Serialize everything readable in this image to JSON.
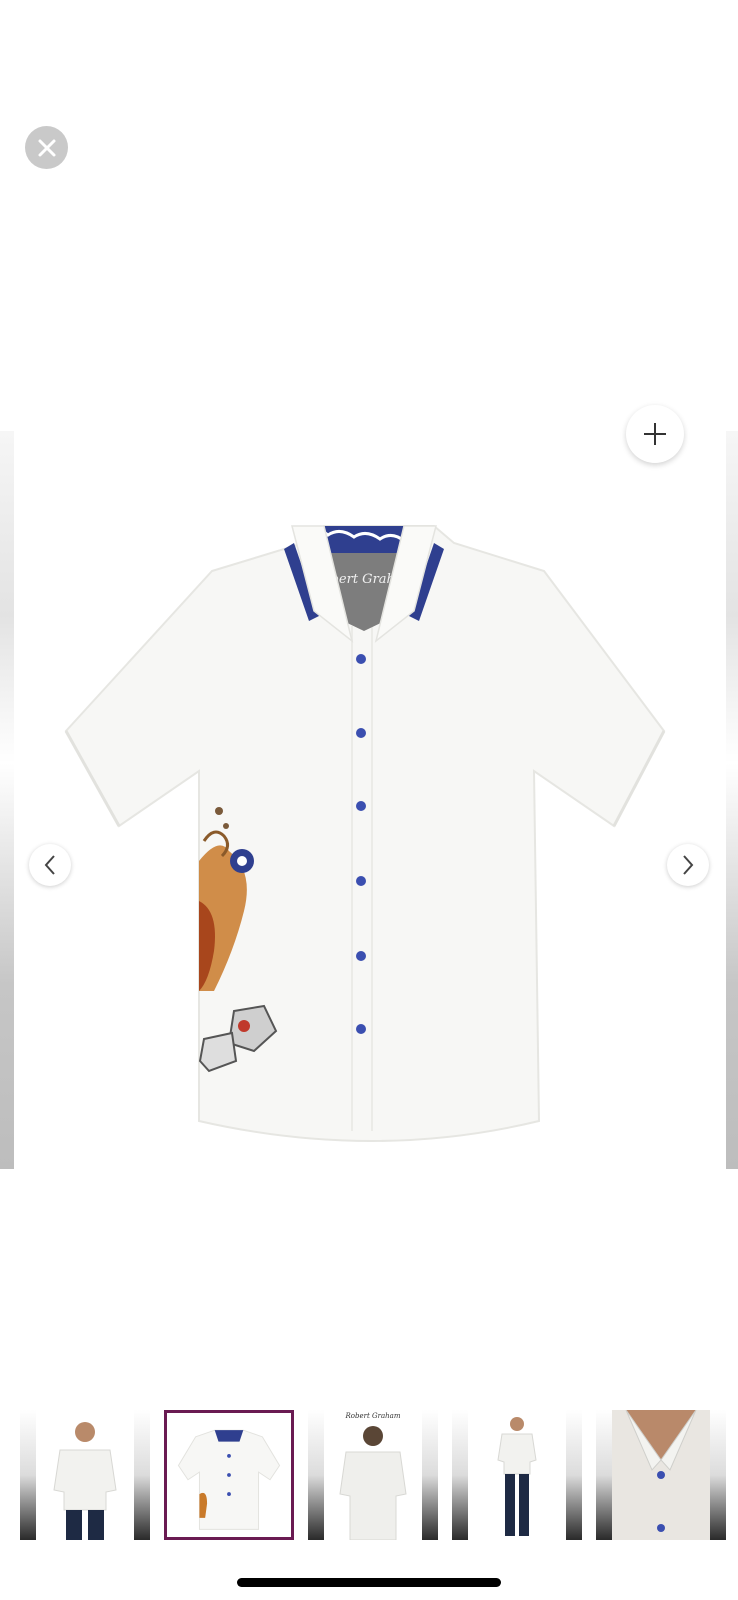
{
  "viewer": {
    "close_icon": "close-icon",
    "zoom_icon": "plus-icon",
    "prev_icon": "chevron-left-icon",
    "next_icon": "chevron-right-icon",
    "main_image_logo_text": "Robert Graham"
  },
  "thumbnails": [
    {
      "icon": "model-front-photo",
      "selected": false
    },
    {
      "icon": "shirt-flat-photo",
      "selected": true
    },
    {
      "icon": "model-back-photo",
      "selected": false,
      "logo_text": "Robert Graham"
    },
    {
      "icon": "model-full-length-photo",
      "selected": false
    },
    {
      "icon": "collar-detail-photo",
      "selected": false
    }
  ],
  "colors": {
    "selected_border": "#6a1b52",
    "button_blue": "#3b4fb0",
    "paisley_blue": "#2f3f8f"
  }
}
